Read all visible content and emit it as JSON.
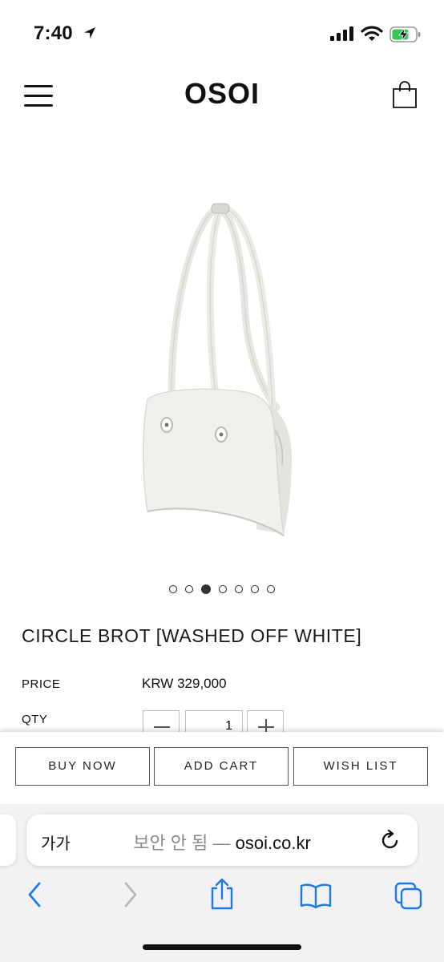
{
  "status_bar": {
    "time": "7:40"
  },
  "header": {
    "brand": "OSOI"
  },
  "product": {
    "title": "CIRCLE BROT [WASHED OFF WHITE]",
    "price_label": "PRICE",
    "price": "KRW 329,000",
    "qty_label": "QTY",
    "qty": "1",
    "image_count": 7,
    "active_image": 3
  },
  "actions": {
    "buy_now": "BUY NOW",
    "add_cart": "ADD CART",
    "wish_list": "WISH LIST"
  },
  "browser": {
    "text_size": "가가",
    "insecure": "보안 안 됨 —",
    "host": "osoi.co.kr"
  },
  "colors": {
    "accent": "#1a7ae6",
    "text": "#111111",
    "battery": "#34c759"
  }
}
